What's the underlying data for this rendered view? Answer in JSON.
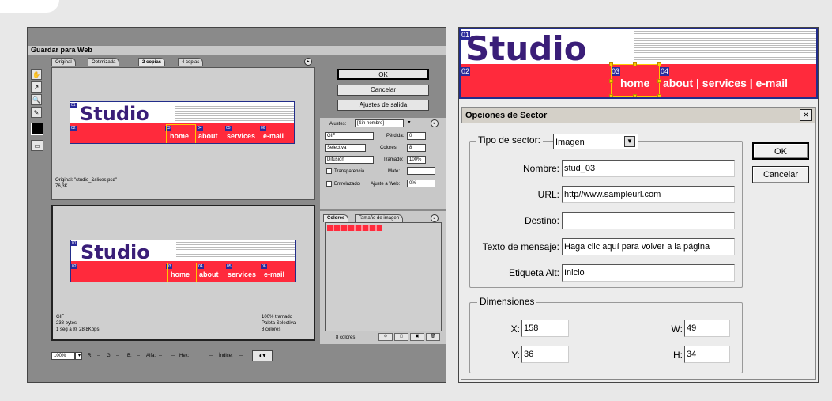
{
  "left_window": {
    "title": "Guardar para Web",
    "tabs": [
      "Original",
      "Optimizada",
      "2 copias",
      "4 copias"
    ],
    "buttons": {
      "ok": "OK",
      "cancel": "Cancelar",
      "output": "Ajustes de salida"
    },
    "settings": {
      "label": "Ajustes:",
      "preset": "[Sin nombre]",
      "format": "GIF",
      "lossy_label": "Pérdida:",
      "lossy_value": "0",
      "reduction": "Selectiva",
      "colors_label": "Colores:",
      "colors_value": "8",
      "dither_algo": "Difusión",
      "dither_label": "Tramado:",
      "dither_value": "100%",
      "transparency": "Transparencia",
      "matte_label": "Mate:",
      "interlaced": "Entrelazado",
      "web_snap": "Ajuste a Web:",
      "web_snap_value": "0%"
    },
    "color_tabs": [
      "Colores",
      "Tamaño de imagen"
    ],
    "colors_count": "8 colores",
    "pane_top_info": {
      "line1": "Original: \"studio_&slices.psd\"",
      "line2": "76,3K"
    },
    "pane_bottom_info": {
      "line1": "GIF",
      "line2": "238 bytes",
      "line3": "1 seg a @ 28,8Kbps",
      "right1": "100% tramado",
      "right2": "Paleta Selectiva",
      "right3": "8 colores"
    },
    "statusbar": {
      "zoom": "100%",
      "r": "R:",
      "r_val": "--",
      "g": "G:",
      "g_val": "--",
      "b": "B:",
      "b_val": "--",
      "alpha": "Alfa:",
      "alpha_val": "--",
      "hex": "Hex:",
      "hex_val": "--",
      "index": "Índice:",
      "index_val": "--"
    }
  },
  "banner": {
    "brand": "Studio",
    "slices": [
      "01",
      "02",
      "03",
      "04",
      "05",
      "06"
    ],
    "nav_small": [
      "home",
      "about",
      "services",
      "e-mail"
    ],
    "nav_large": "about | services | e-mail",
    "nav_large_home": "home"
  },
  "dialog": {
    "title": "Opciones de Sector",
    "close": "×",
    "tipo_label": "Tipo de sector:",
    "tipo_value": "Imagen",
    "ok": "OK",
    "cancel": "Cancelar",
    "fields": {
      "nombre_label": "Nombre:",
      "nombre_value": "stud_03",
      "url_label": "URL:",
      "url_value": "http//www.sampleurl.com",
      "destino_label": "Destino:",
      "destino_value": "",
      "mensaje_label": "Texto de mensaje:",
      "mensaje_value": "Haga clic aquí para volver a la página",
      "alt_label": "Etiqueta Alt:",
      "alt_value": "Inicio"
    },
    "dimensions": {
      "legend": "Dimensiones",
      "x_label": "X:",
      "x_value": "158",
      "y_label": "Y:",
      "y_value": "36",
      "w_label": "W:",
      "w_value": "49",
      "h_label": "H:",
      "h_value": "34"
    }
  },
  "colors": {
    "banner_red": "#ff2a3c",
    "brand_purple": "#3a1e78",
    "slice_blue": "#2a2a9a",
    "selection_yellow": "#ffc800"
  }
}
